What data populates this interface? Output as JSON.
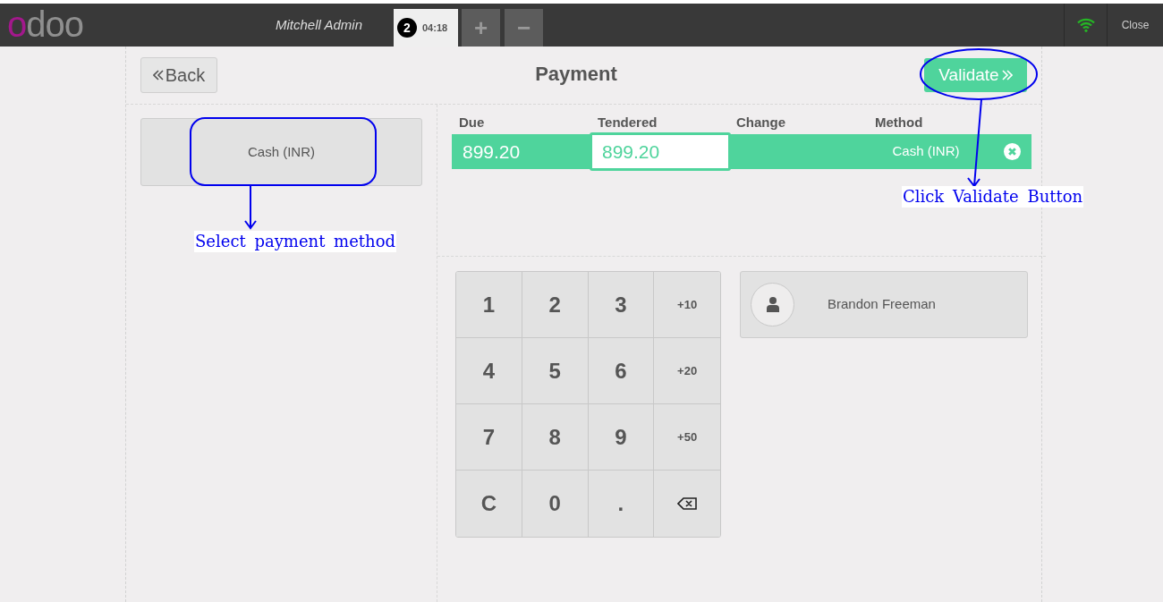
{
  "topbar": {
    "logo": "odoo",
    "user": "Mitchell Admin",
    "order_tabs": [
      {
        "number": "2",
        "time": "04:18",
        "selected": true
      }
    ],
    "add_order": "+",
    "remove_order": "−",
    "close": "Close"
  },
  "header": {
    "back": "Back",
    "title": "Payment",
    "validate": "Validate"
  },
  "payment_methods": [
    {
      "label": "Cash (INR)"
    }
  ],
  "payment_lines": {
    "columns": [
      "Due",
      "Tendered",
      "Change",
      "Method"
    ],
    "rows": [
      {
        "due": "899.20",
        "tendered": "899.20",
        "method": "Cash (INR)",
        "selected": true
      }
    ]
  },
  "keypad": [
    {
      "kind": "digit",
      "label": "1"
    },
    {
      "kind": "digit",
      "label": "2"
    },
    {
      "kind": "digit",
      "label": "3"
    },
    {
      "kind": "plus",
      "label": "+10"
    },
    {
      "kind": "digit",
      "label": "4"
    },
    {
      "kind": "digit",
      "label": "5"
    },
    {
      "kind": "digit",
      "label": "6"
    },
    {
      "kind": "plus",
      "label": "+20"
    },
    {
      "kind": "digit",
      "label": "7"
    },
    {
      "kind": "digit",
      "label": "8"
    },
    {
      "kind": "digit",
      "label": "9"
    },
    {
      "kind": "plus",
      "label": "+50"
    },
    {
      "kind": "digit",
      "label": "C"
    },
    {
      "kind": "digit",
      "label": "0"
    },
    {
      "kind": "digit",
      "label": "."
    },
    {
      "kind": "backspace"
    }
  ],
  "customer": {
    "name": "Brandon Freeman"
  },
  "annotations": [
    {
      "text": "Select payment method"
    },
    {
      "text": "Click Validate Button"
    }
  ]
}
